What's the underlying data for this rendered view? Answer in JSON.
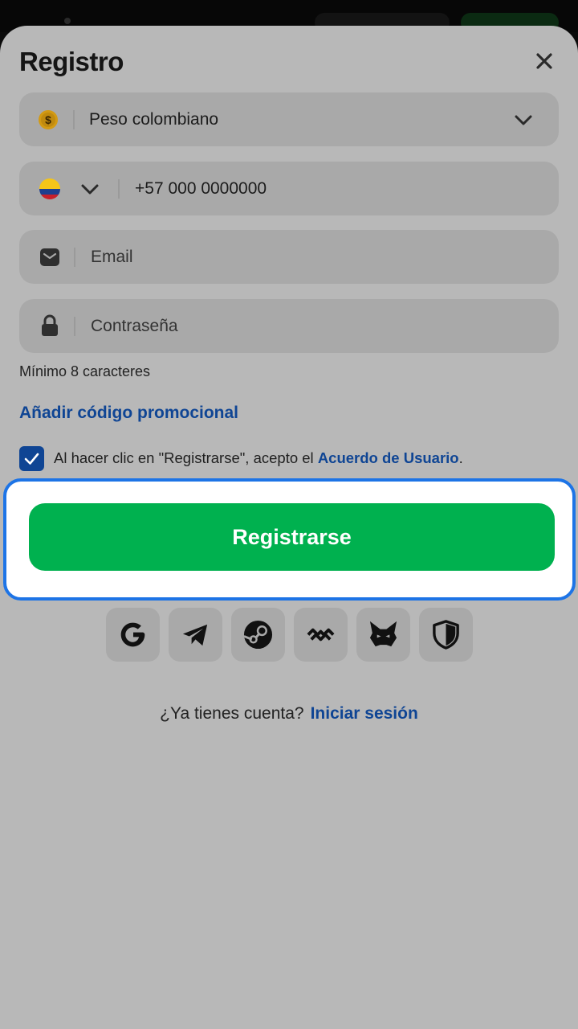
{
  "title": "Registro",
  "currency": {
    "icon": "dollar-coin-icon",
    "value": "Peso colombiano"
  },
  "phone": {
    "flag": "colombia-flag-icon",
    "placeholder": "+57 000 0000000"
  },
  "email": {
    "placeholder": "Email"
  },
  "password": {
    "placeholder": "Contraseña",
    "hint": "Mínimo 8 caracteres"
  },
  "promo_link": "Añadir código promocional",
  "agreement": {
    "checked": true,
    "text": "Al hacer clic en \"Registrarse\", acepto el",
    "link": "Acuerdo de Usuario",
    "end": "."
  },
  "register_button": "Registrarse",
  "social_logins": [
    "google-icon",
    "telegram-icon",
    "steam-icon",
    "walletconnect-icon",
    "metamask-fox-icon",
    "shield-icon"
  ],
  "login_prompt": {
    "question": "¿Ya tienes cuenta?",
    "link": "Iniciar sesión"
  },
  "colors": {
    "accent_green": "#00b14f",
    "link_blue": "#0f4594",
    "highlight_border": "#1d74e6",
    "overlay_gray": "#b8b8b8"
  }
}
